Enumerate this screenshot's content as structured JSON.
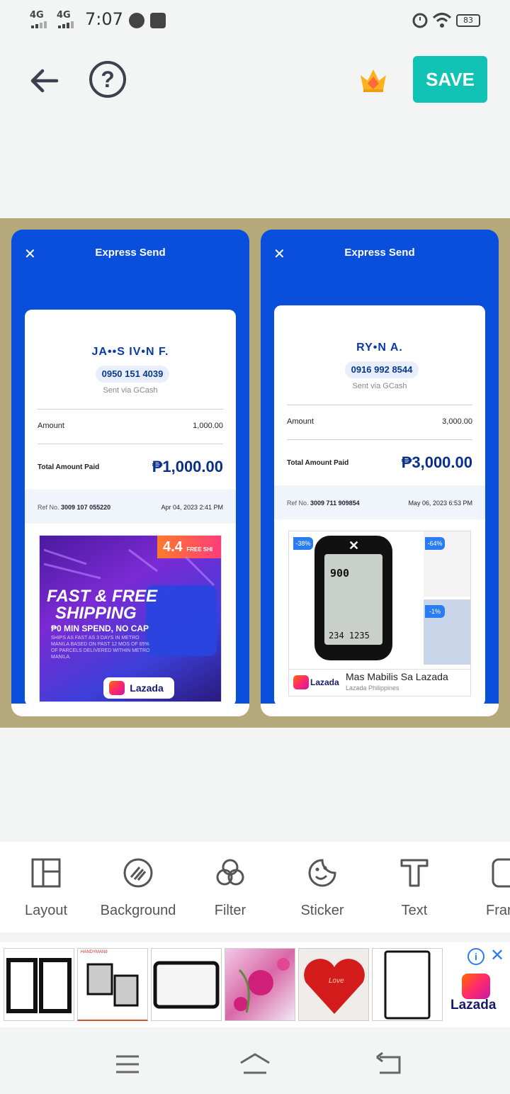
{
  "status_bar": {
    "signal1": "4G",
    "signal2": "4G",
    "time": "7:07",
    "battery": "83"
  },
  "toolbar": {
    "save_label": "SAVE"
  },
  "receipt_left": {
    "title": "Express Send",
    "recipient": "JA••S IV•N F.",
    "phone": "0950 151 4039",
    "via": "Sent via GCash",
    "amount_label": "Amount",
    "amount": "1,000.00",
    "total_label": "Total Amount Paid",
    "total": "₱1,000.00",
    "ref_label": "Ref No.",
    "ref_no": "3009 107 055220",
    "date": "Apr 04, 2023 2:41 PM",
    "ad": {
      "badge": "4.4",
      "badge_sub": "FREE SHI",
      "headline1": "FAST & FREE",
      "headline2": "SHIPPING",
      "sub": "₱0 MIN SPEND, NO CAP",
      "small": "SHIPS AS FAST AS 3 DAYS IN METRO MANILA BASED ON PAST 12 MOS OF 65% OF PARCELS DELIVERED WITHIN METRO MANILA.",
      "brand": "Lazada"
    }
  },
  "receipt_right": {
    "title": "Express Send",
    "recipient": "RY•N A.",
    "phone": "0916 992 8544",
    "via": "Sent via GCash",
    "amount_label": "Amount",
    "amount": "3,000.00",
    "total_label": "Total Amount Paid",
    "total": "₱3,000.00",
    "ref_label": "Ref No.",
    "ref_no": "3009 711 909854",
    "date": "May 06, 2023 6:53 PM",
    "ad": {
      "discount1": "-38%",
      "discount2": "-64%",
      "discount3": "-1%",
      "gps_speed": "900",
      "gps_stats": "234 1235",
      "brand": "Lazada",
      "headline": "Mas Mabilis Sa Lazada",
      "advertiser": "Lazada Philippines"
    }
  },
  "tools": [
    {
      "label": "Layout",
      "icon": "layout-icon"
    },
    {
      "label": "Background",
      "icon": "background-icon"
    },
    {
      "label": "Filter",
      "icon": "filter-icon"
    },
    {
      "label": "Sticker",
      "icon": "sticker-icon"
    },
    {
      "label": "Text",
      "icon": "text-icon"
    },
    {
      "label": "Fran",
      "icon": "frame-icon"
    }
  ],
  "frames_ad": {
    "brand": "Lazada",
    "thumb2_caption": "HANDYMAN8",
    "thumb5_caption": "Love"
  }
}
